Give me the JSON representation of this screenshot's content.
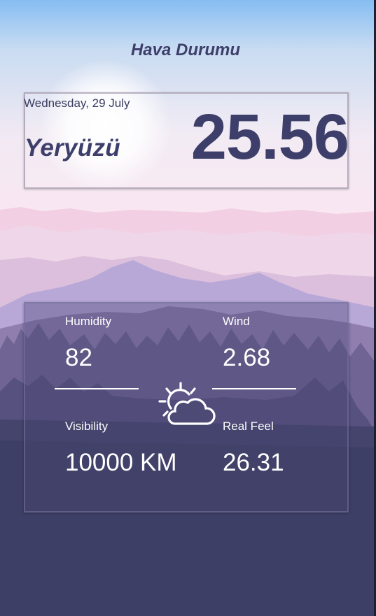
{
  "app": {
    "title": "Hava Durumu"
  },
  "location": {
    "date": "Wednesday, 29 July",
    "city": "Yeryüzü",
    "temperature": "25.56"
  },
  "stats": {
    "humidity": {
      "label": "Humidity",
      "value": "82"
    },
    "wind": {
      "label": "Wind",
      "value": "2.68"
    },
    "visibility": {
      "label": "Visibility",
      "value": "10000 KM"
    },
    "real_feel": {
      "label": "Real Feel",
      "value": "26.31"
    }
  },
  "icons": {
    "weather": "partly-sunny-icon"
  },
  "colors": {
    "accent": "#3d3f6a",
    "background_bottom": "#3e3f66",
    "sky_top": "#86bdf2"
  }
}
